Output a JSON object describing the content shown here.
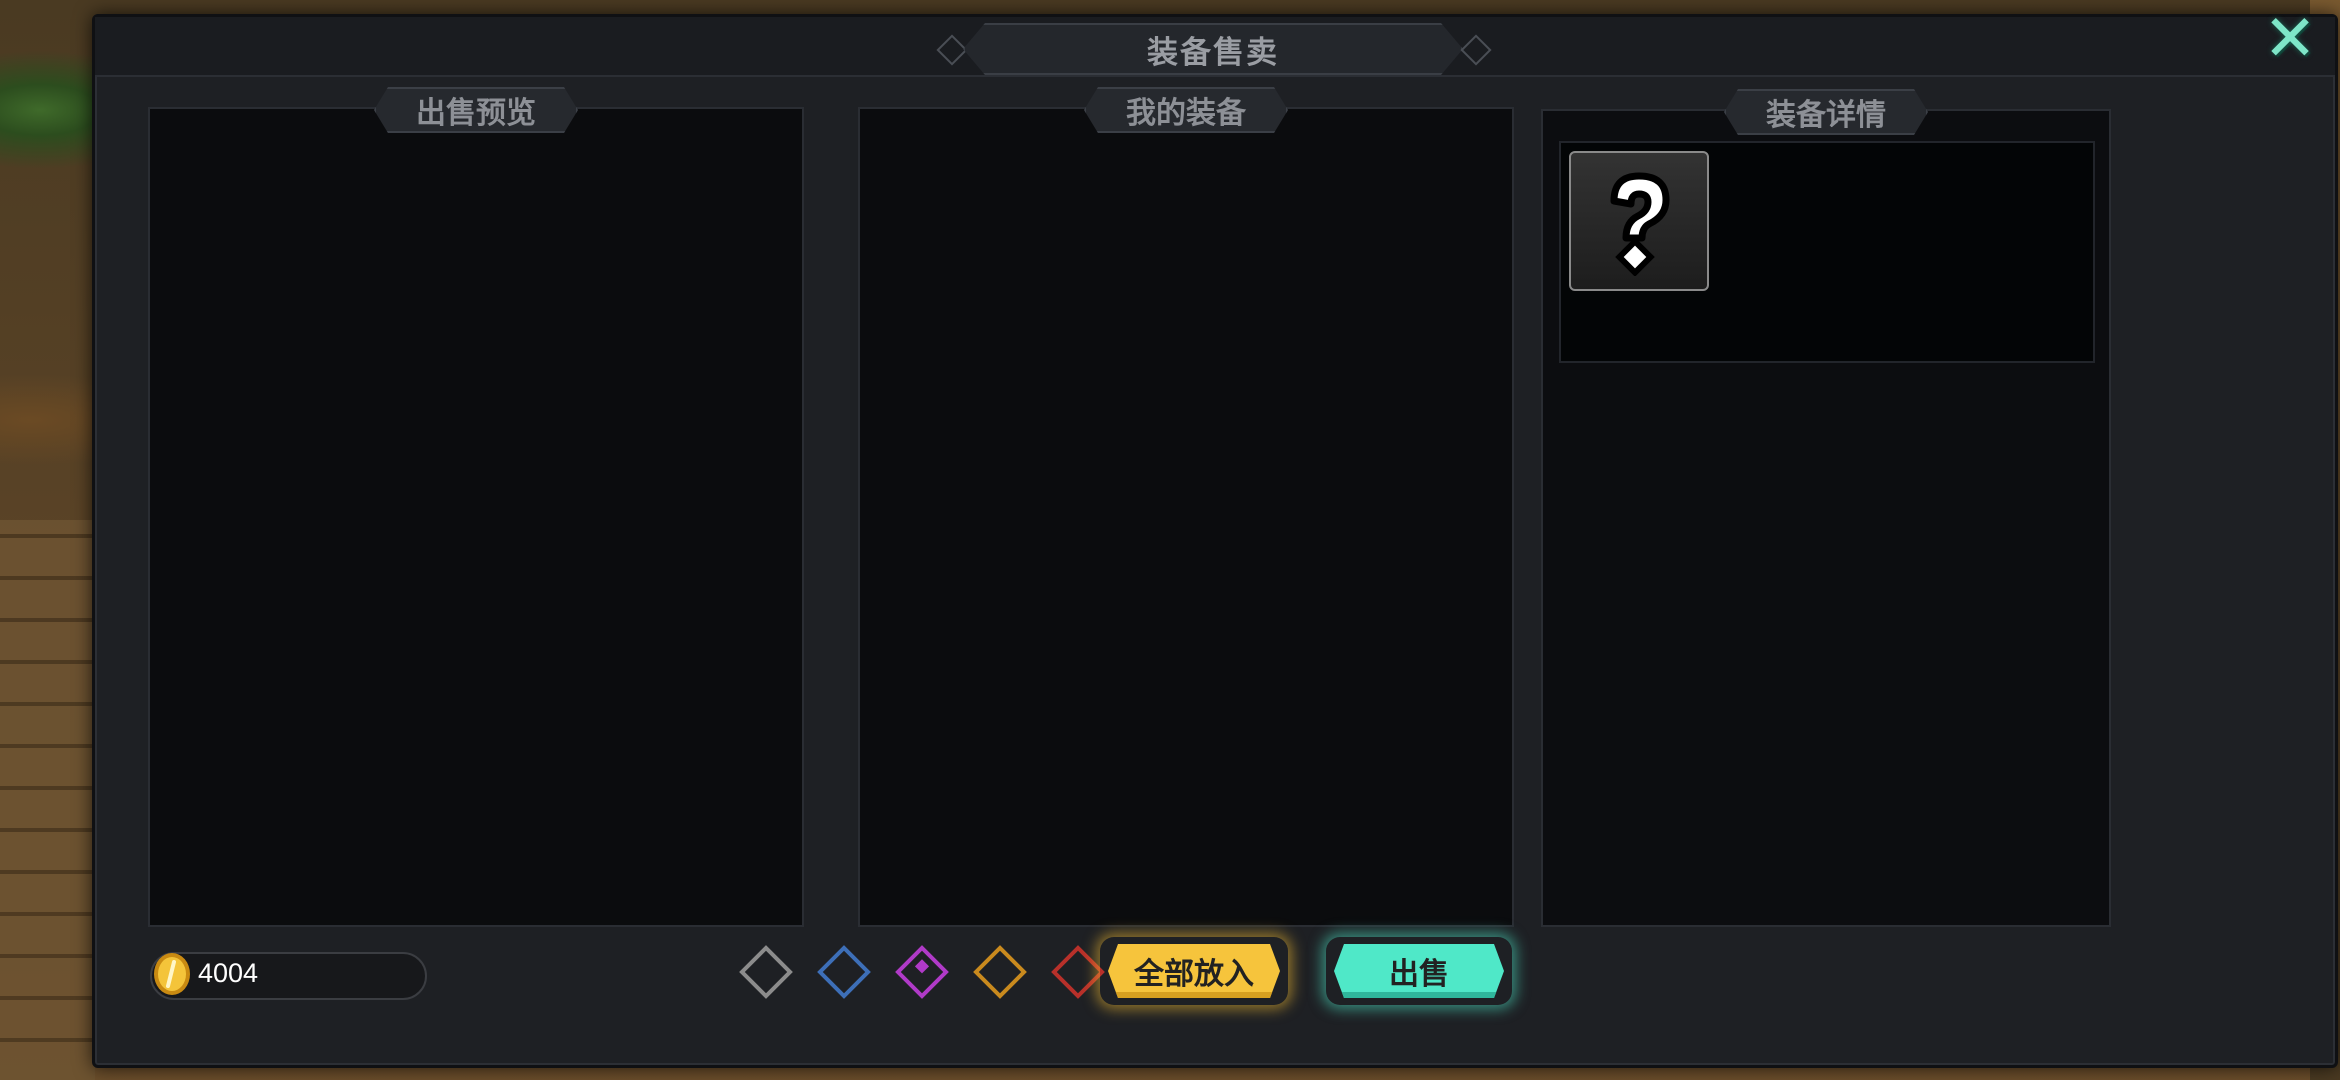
{
  "dialog": {
    "title": "装备售卖",
    "close_icon": "close-icon"
  },
  "panels": {
    "preview": {
      "title": "出售预览"
    },
    "mine": {
      "title": "我的装备"
    },
    "detail": {
      "title": "装备详情",
      "item_icon": "question-mark-icon"
    }
  },
  "footer": {
    "gold_amount": "4004",
    "gold_icon": "coin-icon",
    "rarity_filters": [
      {
        "name": "common",
        "color": "#8c8c8c"
      },
      {
        "name": "uncommon",
        "color": "#3d6fb8"
      },
      {
        "name": "rare",
        "color": "#b03ac8",
        "selected": true
      },
      {
        "name": "epic",
        "color": "#c98a1e"
      },
      {
        "name": "legendary",
        "color": "#b8302a"
      }
    ],
    "add_all_label": "全部放入",
    "sell_label": "出售"
  }
}
